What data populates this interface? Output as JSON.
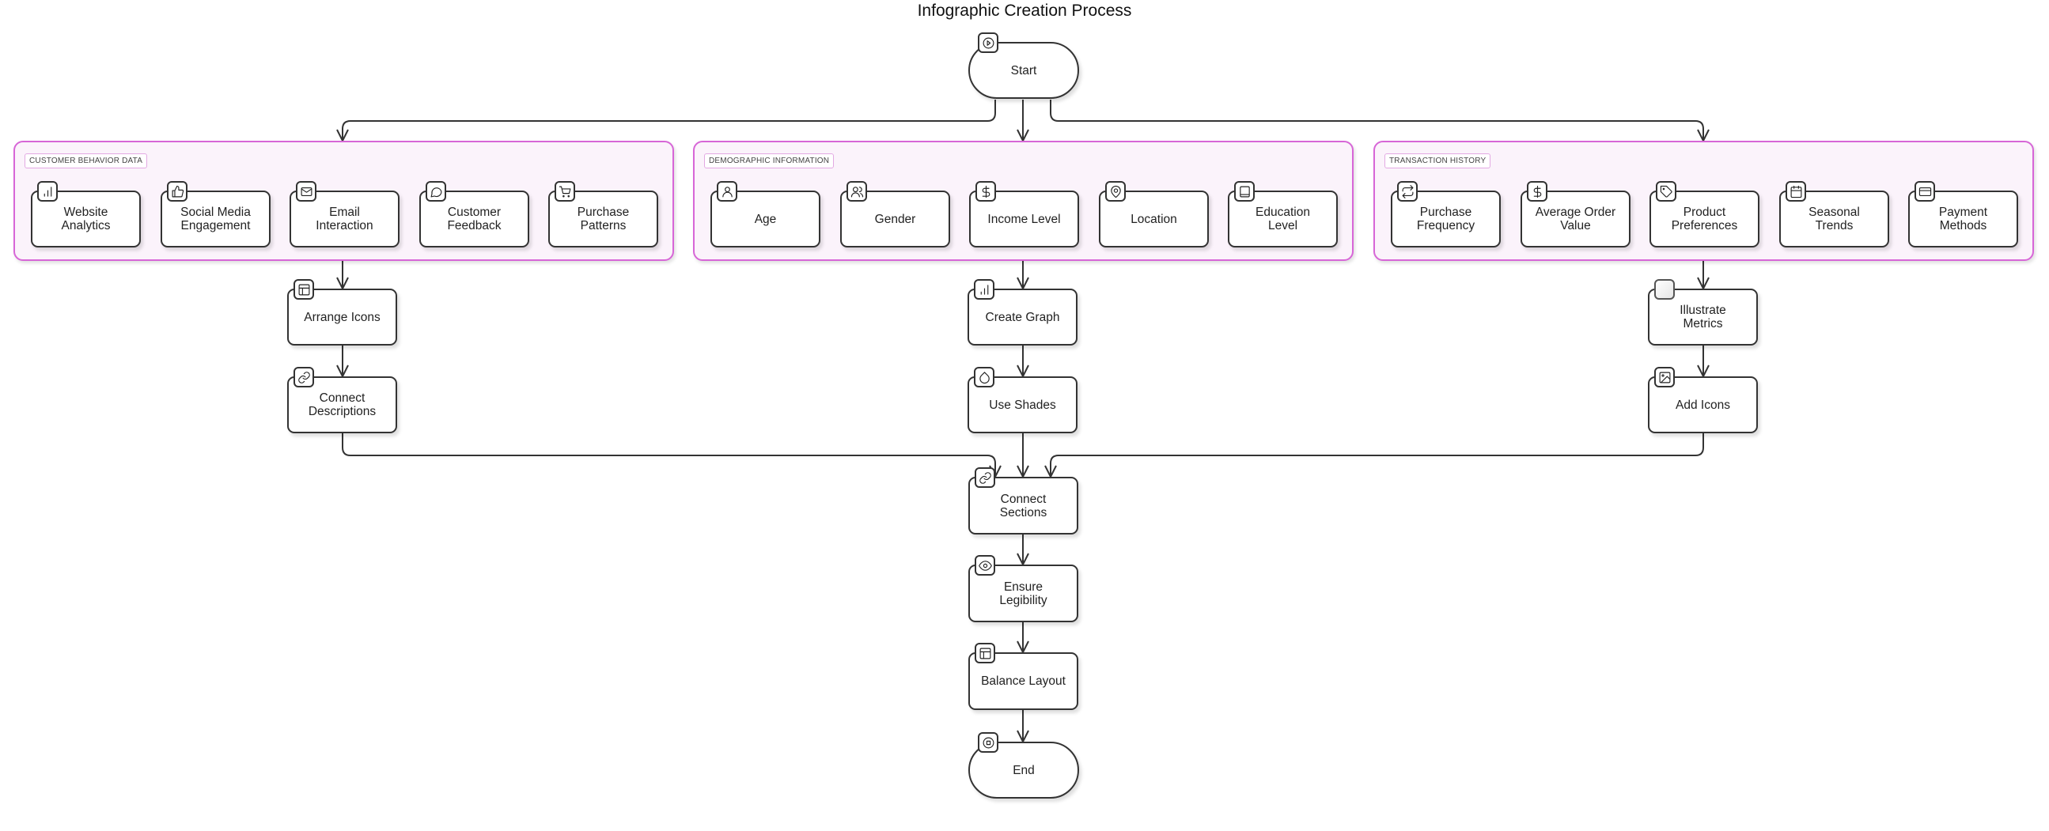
{
  "title": "Infographic Creation Process",
  "colors": {
    "group_border": "#d766d7",
    "group_fill": "#fbf3fb",
    "node_border": "#333333"
  },
  "start": {
    "label": "Start",
    "icon": "play-icon"
  },
  "end": {
    "label": "End",
    "icon": "stop-icon"
  },
  "groups": [
    {
      "label": "CUSTOMER BEHAVIOR DATA",
      "items": [
        {
          "label": "Website Analytics",
          "icon": "bar-chart-icon"
        },
        {
          "label": "Social Media Engagement",
          "icon": "thumbs-up-icon"
        },
        {
          "label": "Email Interaction",
          "icon": "mail-icon"
        },
        {
          "label": "Customer Feedback",
          "icon": "message-circle-icon"
        },
        {
          "label": "Purchase Patterns",
          "icon": "shopping-cart-icon"
        }
      ],
      "steps": [
        {
          "label": "Arrange Icons",
          "icon": "layout-icon"
        },
        {
          "label": "Connect Descriptions",
          "icon": "link-icon"
        }
      ]
    },
    {
      "label": "DEMOGRAPHIC INFORMATION",
      "items": [
        {
          "label": "Age",
          "icon": "user-icon"
        },
        {
          "label": "Gender",
          "icon": "users-icon"
        },
        {
          "label": "Income Level",
          "icon": "dollar-icon"
        },
        {
          "label": "Location",
          "icon": "map-pin-icon"
        },
        {
          "label": "Education Level",
          "icon": "book-icon"
        }
      ],
      "steps": [
        {
          "label": "Create Graph",
          "icon": "bar-chart-icon"
        },
        {
          "label": "Use Shades",
          "icon": "droplet-icon"
        }
      ]
    },
    {
      "label": "TRANSACTION HISTORY",
      "items": [
        {
          "label": "Purchase Frequency",
          "icon": "repeat-icon"
        },
        {
          "label": "Average Order Value",
          "icon": "dollar-icon"
        },
        {
          "label": "Product Preferences",
          "icon": "tag-icon"
        },
        {
          "label": "Seasonal Trends",
          "icon": "calendar-icon"
        },
        {
          "label": "Payment Methods",
          "icon": "credit-card-icon"
        }
      ],
      "steps": [
        {
          "label": "Illustrate Metrics",
          "icon": "blank-icon"
        },
        {
          "label": "Add Icons",
          "icon": "image-icon"
        }
      ]
    }
  ],
  "final_steps": [
    {
      "label": "Connect Sections",
      "icon": "link-icon"
    },
    {
      "label": "Ensure Legibility",
      "icon": "eye-icon"
    },
    {
      "label": "Balance Layout",
      "icon": "layout-icon"
    }
  ]
}
